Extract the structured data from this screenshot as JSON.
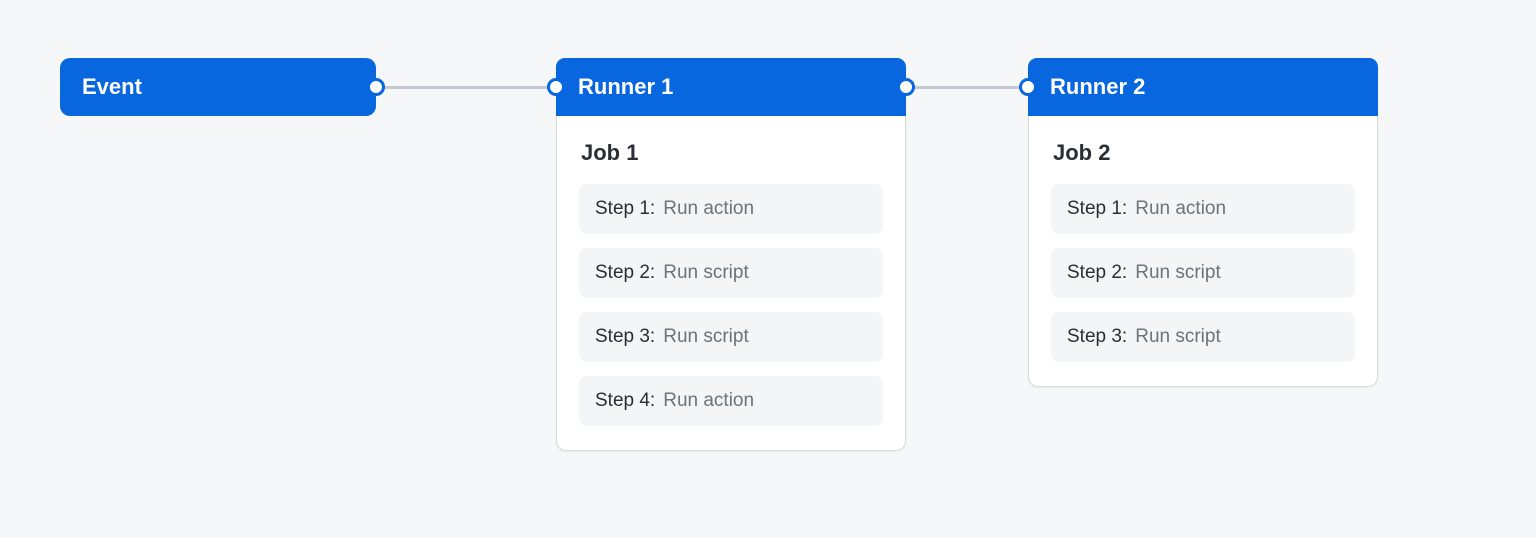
{
  "colors": {
    "accent": "#0866df",
    "bg": "#f6f7f8",
    "card_bg": "#ffffff",
    "step_bg": "#f4f5f6",
    "muted_text": "#6a727b",
    "border": "#d4d9de"
  },
  "event": {
    "title": "Event"
  },
  "runners": [
    {
      "title": "Runner 1",
      "job_title": "Job 1",
      "steps": [
        {
          "label": "Step 1:",
          "desc": "Run action"
        },
        {
          "label": "Step 2:",
          "desc": "Run script"
        },
        {
          "label": "Step 3:",
          "desc": "Run script"
        },
        {
          "label": "Step 4:",
          "desc": "Run action"
        }
      ]
    },
    {
      "title": "Runner 2",
      "job_title": "Job 2",
      "steps": [
        {
          "label": "Step 1:",
          "desc": "Run action"
        },
        {
          "label": "Step 2:",
          "desc": "Run script"
        },
        {
          "label": "Step 3:",
          "desc": "Run script"
        }
      ]
    }
  ]
}
